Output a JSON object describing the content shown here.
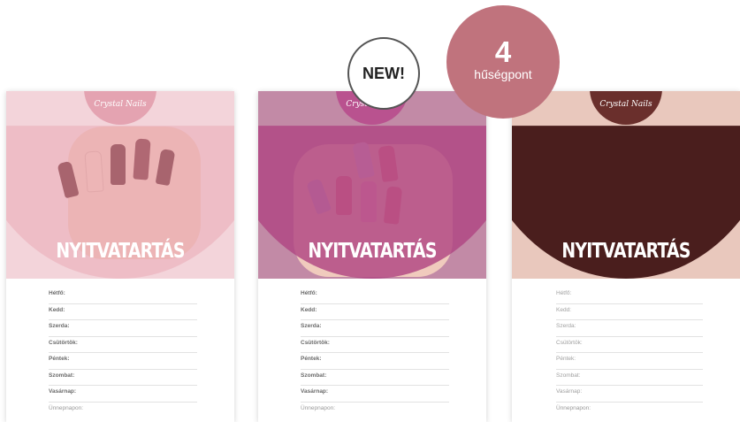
{
  "badges": {
    "new_label": "NEW!",
    "points_value": "4",
    "points_label": "hűségpont",
    "points_color": "#c0737d"
  },
  "cards": [
    {
      "logo": "Crystal Nails",
      "title": "NYITVATARTÁS",
      "theme_color": "#e9a9b6",
      "days": [
        "Hétfő:",
        "Kedd:",
        "Szerda:",
        "Csütörtök:",
        "Péntek:",
        "Szombat:",
        "Vasárnap:",
        "Ünnepnapon:"
      ]
    },
    {
      "logo": "Crystal Nails",
      "title": "NYITVATARTÁS",
      "theme_color": "#b9528f",
      "days": [
        "Hétfő:",
        "Kedd:",
        "Szerda:",
        "Csütörtök:",
        "Péntek:",
        "Szombat:",
        "Vasárnap:",
        "Ünnepnapon:"
      ]
    },
    {
      "logo": "Crystal Nails",
      "title": "NYITVATARTÁS",
      "theme_color": "#4a1e1d",
      "days": [
        "Hétfő:",
        "Kedd:",
        "Szerda:",
        "Csütörtök:",
        "Péntek:",
        "Szombat:",
        "Vasárnap:",
        "Ünnepnapon:"
      ]
    }
  ]
}
